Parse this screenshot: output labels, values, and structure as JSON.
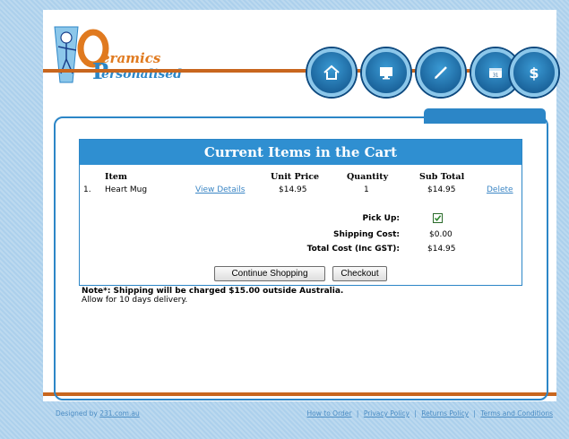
{
  "brand": {
    "logo_top": "eramics",
    "logo_bottom": "ersonalised"
  },
  "nav": [
    {
      "name": "home-icon"
    },
    {
      "name": "monitor-icon"
    },
    {
      "name": "pen-icon"
    },
    {
      "name": "calendar-icon",
      "label": "31"
    },
    {
      "name": "dollar-icon",
      "label": "$"
    }
  ],
  "cart": {
    "title": "Current Items in the Cart",
    "columns": {
      "item": "Item",
      "unit_price": "Unit Price",
      "quantity": "Quantity",
      "sub_total": "Sub Total"
    },
    "rows": [
      {
        "num": "1.",
        "name": "Heart Mug",
        "details_link": "View Details",
        "unit_price": "$14.95",
        "quantity": "1",
        "sub_total": "$14.95",
        "delete_link": "Delete"
      }
    ],
    "pickup_label": "Pick Up:",
    "pickup_checked": true,
    "shipping_label": "Shipping Cost:",
    "shipping_value": "$0.00",
    "total_label": "Total Cost (Inc GST):",
    "total_value": "$14.95",
    "continue_button": "Continue Shopping",
    "checkout_button": "Checkout"
  },
  "note": {
    "bold": "Note*: Shipping will be charged $15.00 outside Australia.",
    "line2": "Allow for 10 days delivery."
  },
  "footer": {
    "designed_by": "Designed by",
    "designer_link": "231.com.au",
    "links": [
      "How to Order",
      "Privacy Policy",
      "Returns Policy",
      "Terms and Conditions"
    ],
    "separator": "|"
  },
  "colors": {
    "accent": "#2f8fd1",
    "brand_orange": "#c8661e",
    "link": "#3b86c5"
  }
}
